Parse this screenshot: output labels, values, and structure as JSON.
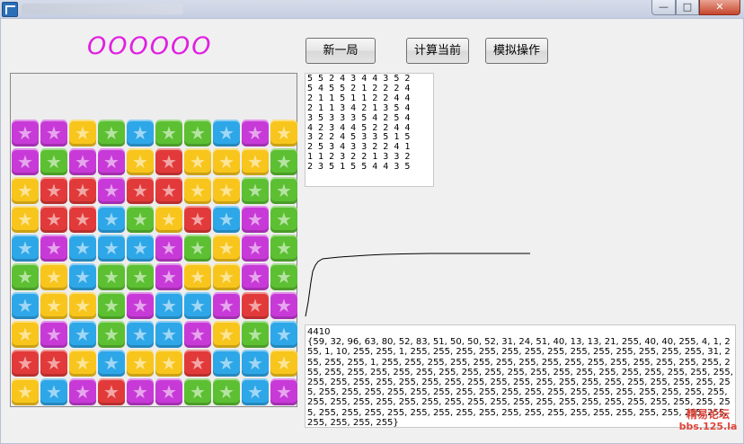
{
  "window": {
    "title": "",
    "min_icon": "minimize-icon",
    "max_icon": "maximize-icon",
    "close_icon": "close-icon"
  },
  "score": "OOOOOO",
  "buttons": {
    "new_game": "新一局",
    "calculate": "计算当前",
    "simulate": "模拟操作"
  },
  "matrix_rows": [
    "5 5 2 4 3 4 4 3 5 2",
    "5 4 5 5 2 1 2 2 2 4",
    "2 1 1 5 1 1 2 2 4 4",
    "2 1 1 3 4 2 1 3 5 4",
    "3 5 3 3 3 5 4 2 5 4",
    "4 2 3 4 4 5 2 2 4 4",
    "3 2 2 4 5 3 3 5 1 5",
    "2 5 3 4 3 3 2 2 4 1",
    "1 1 2 3 2 2 1 3 3 2",
    "2 3 5 1 5 5 4 4 3 5"
  ],
  "board": {
    "colors": {
      "1": "#e23a3a",
      "2": "#2ea7e8",
      "3": "#c83ad8",
      "4": "#5cc032",
      "5": "#f8c51c"
    },
    "rows": [
      [
        3,
        3,
        5,
        4,
        2,
        4,
        4,
        2,
        3,
        5
      ],
      [
        3,
        4,
        3,
        3,
        5,
        1,
        5,
        5,
        5,
        4
      ],
      [
        5,
        1,
        1,
        3,
        1,
        1,
        5,
        5,
        4,
        4
      ],
      [
        5,
        1,
        1,
        2,
        4,
        5,
        1,
        2,
        3,
        4
      ],
      [
        2,
        3,
        2,
        2,
        2,
        3,
        4,
        5,
        3,
        4
      ],
      [
        4,
        5,
        2,
        4,
        4,
        3,
        5,
        5,
        3,
        4
      ],
      [
        2,
        5,
        5,
        4,
        3,
        2,
        2,
        3,
        1,
        3
      ],
      [
        5,
        3,
        2,
        4,
        2,
        2,
        3,
        5,
        4,
        2
      ],
      [
        1,
        1,
        5,
        2,
        5,
        5,
        1,
        2,
        2,
        5
      ],
      [
        5,
        2,
        3,
        1,
        3,
        3,
        4,
        4,
        2,
        3
      ]
    ]
  },
  "output": {
    "count": "4410",
    "array": "{59, 32, 96, 63, 80, 52, 83, 51, 50, 50, 52, 31, 24, 51, 40, 13, 13, 21, 255, 40, 40, 255, 4, 1, 255, 1, 10, 255, 255, 1, 255, 255, 255, 255, 255, 255, 255, 255, 255, 255, 255, 255, 255, 31, 255, 255, 255, 1, 255, 255, 255, 255, 255, 255, 255, 255, 255, 255, 255, 255, 255, 255, 255, 255, 255, 255, 255, 255, 255, 255, 255, 255, 255, 255, 255, 255, 255, 255, 255, 255, 255, 255, 255, 255, 255, 255, 255, 255, 255, 255, 255, 255, 255, 255, 255, 255, 255, 255, 255, 255, 255, 255, 255, 255, 255, 255, 255, 255, 255, 255, 255, 255, 255, 255, 255, 255, 255, 255, 255, 255, 255, 255, 255, 255, 255, 255, 255, 255, 255, 255, 255, 255, 255, 255, 255, 255, 255, 255, 255, 255, 255, 255, 255, 255, 255, 255, 255, 255, 255, 255, 255, 255, 255, 255, 255, 255, 255, 255, 255, 255}"
  },
  "watermark": {
    "line1": "精易论坛",
    "line2": "bbs.125.la"
  }
}
